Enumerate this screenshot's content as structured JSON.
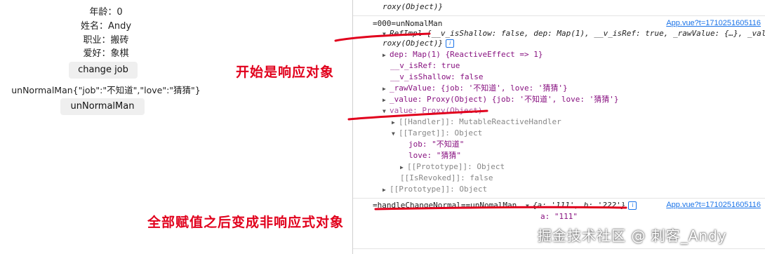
{
  "profile": {
    "age": "年龄：0",
    "name": "姓名：Andy",
    "job": "职业：搬砖",
    "hobby": "爱好：象棋"
  },
  "buttons": {
    "change_job": "change job",
    "unnormal": "unNormalMan"
  },
  "json_text": "unNormalMan{\"job\":\"不知道\",\"love\":\"猜猜\"}",
  "annotations": {
    "first": "开始是响应对象",
    "second": "全部赋值之后变成非响应式对象"
  },
  "console": {
    "top_partial": "roxy(Object)}",
    "log1_label": "=000=unNomalMan",
    "log1_link": "App.vue?t=1710251605116",
    "refimpl": "RefImpl {__v_isShallow: false, dep: Map(1), __v_isRef: true, _rawValue: {…}, _value",
    "proxy_tail": "roxy(Object)}",
    "dep": "dep: Map(1) {ReactiveEffect => 1}",
    "v_isRef": "__v_isRef: true",
    "v_isShallow": "__v_isShallow: false",
    "rawValue": "_rawValue: {job: '不知道', love: '猜猜'}",
    "value_priv": "_value: Proxy(Object) {job: '不知道', love: '猜猜'}",
    "value": "value: Proxy(Object)",
    "handler": "[[Handler]]: MutableReactiveHandler",
    "target": "[[Target]]: Object",
    "job": "job: \"不知道\"",
    "love": "love: \"猜猜\"",
    "proto_inner": "[[Prototype]]: Object",
    "isRevoked": "[[IsRevoked]]: false",
    "proto_outer": "[[Prototype]]: Object",
    "log2_label": "=handleChangeNormal==unNomalMan",
    "log2_obj": "{a: '111', b: '222'}",
    "log2_link": "App.vue?t=1710251605116",
    "a_val": "a: \"111\""
  },
  "watermark": "掘金技术社区 @ 刺客_Andy",
  "colors": {
    "annotation": "#e1001c",
    "link": "#1a73e8",
    "key": "#881280",
    "string": "#c41a16",
    "boolean": "#1a1aa6"
  }
}
